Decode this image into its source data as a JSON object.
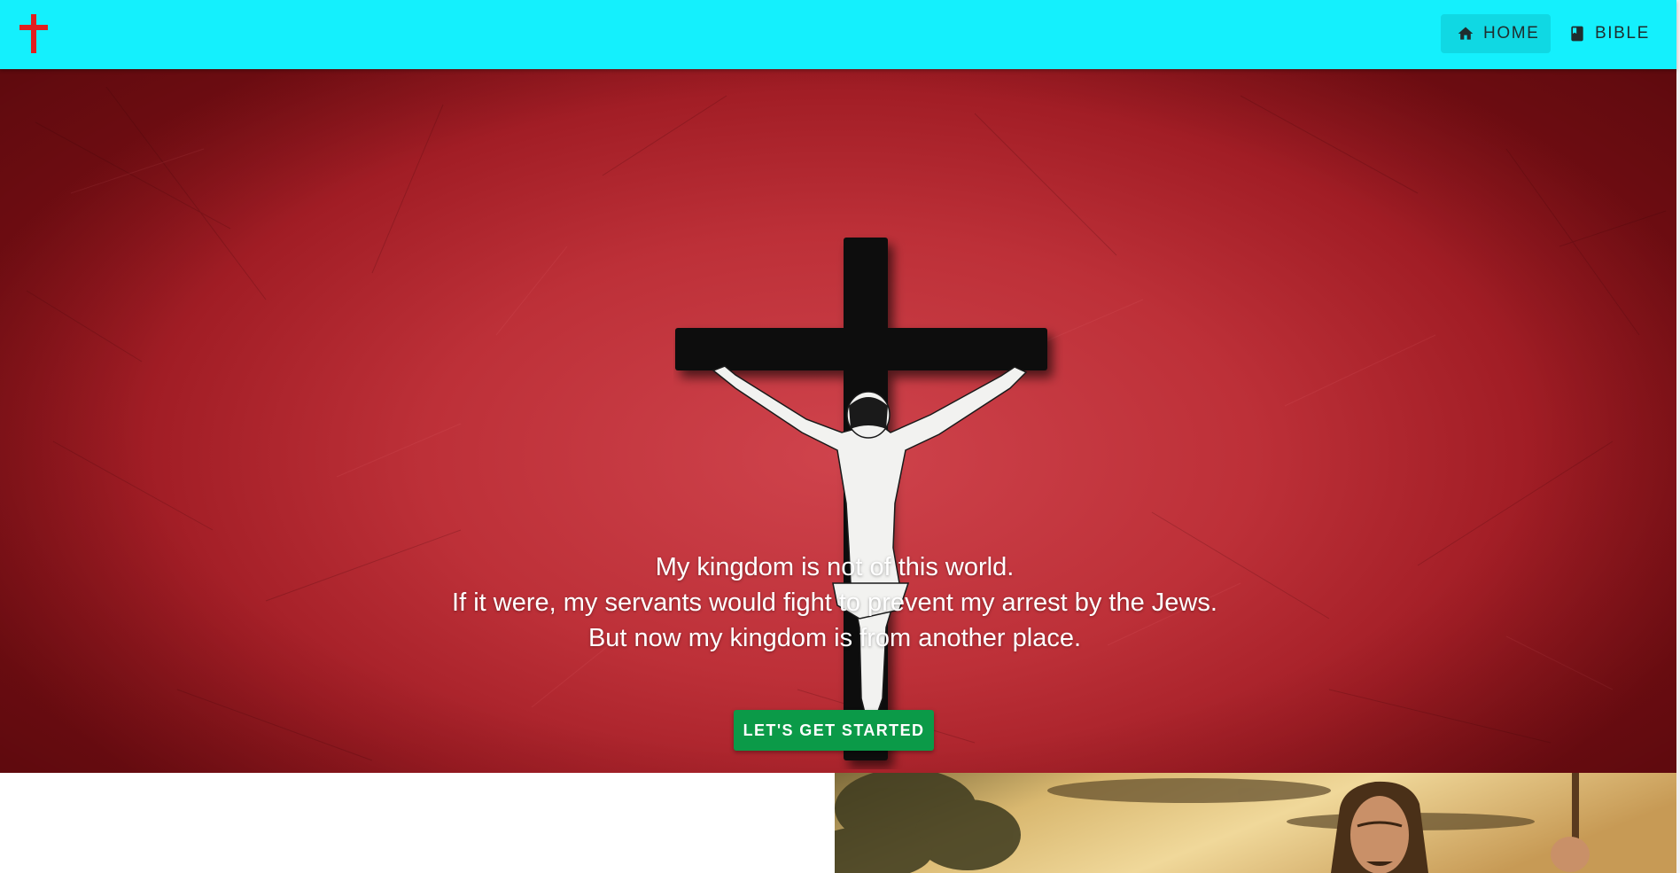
{
  "navbar": {
    "brand_icon": "cross-icon",
    "brand_color": "#e11f1f",
    "background": "#14f0fd",
    "items": [
      {
        "label": "HOME",
        "icon": "home-icon",
        "active": true
      },
      {
        "label": "BIBLE",
        "icon": "book-icon",
        "active": false
      }
    ]
  },
  "hero": {
    "background_color": "#bd3038",
    "quote_lines": [
      "My kingdom is not of this world.",
      "If it were, my servants would fight to prevent my arrest by the Jews.",
      "But now my kingdom is from another place."
    ],
    "cta_label": "LET'S GET STARTED",
    "cta_color": "#0b9a48"
  },
  "painting": {
    "subject": "painting-of-jesus-with-staff"
  }
}
